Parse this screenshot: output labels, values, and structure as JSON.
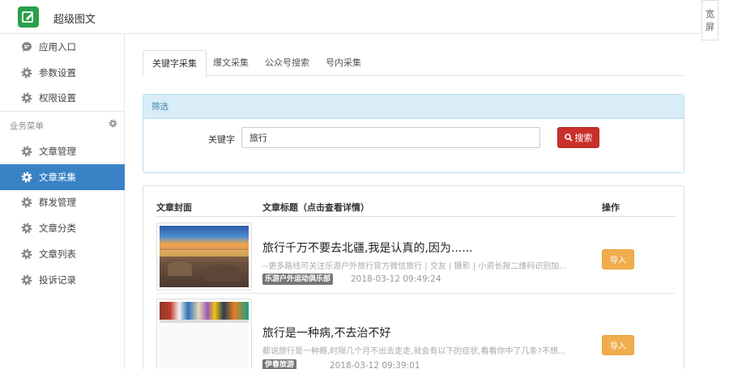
{
  "app": {
    "title": "超级图文",
    "wide_label": "宽屏"
  },
  "sidebar": {
    "top_items": [
      {
        "label": "应用入口",
        "icon": "chat-bubble-icon"
      },
      {
        "label": "参数设置",
        "icon": "gear-icon"
      },
      {
        "label": "权限设置",
        "icon": "gear-icon"
      }
    ],
    "section_label": "业务菜单",
    "items": [
      {
        "label": "文章管理",
        "icon": "gear-icon"
      },
      {
        "label": "文章采集",
        "icon": "gear-icon",
        "active": true
      },
      {
        "label": "群发管理",
        "icon": "gear-icon"
      },
      {
        "label": "文章分类",
        "icon": "gear-icon"
      },
      {
        "label": "文章列表",
        "icon": "gear-icon"
      },
      {
        "label": "投诉记录",
        "icon": "gear-icon"
      }
    ]
  },
  "tabs": [
    {
      "label": "关键字采集",
      "active": true
    },
    {
      "label": "爆文采集"
    },
    {
      "label": "公众号搜索"
    },
    {
      "label": "号内采集"
    }
  ],
  "filter": {
    "heading": "筛选",
    "keyword_label": "关键字",
    "keyword_value": "旅行",
    "search_label": "搜索"
  },
  "table": {
    "headers": {
      "cover": "文章封面",
      "title": "文章标题（点击查看详情）",
      "action": "操作"
    },
    "rows": [
      {
        "title": "旅行千万不要去北疆,我是认真的,因为......",
        "desc": "--更多路线可关注乐游户外旅行官方微信旅行 | 交友 | 摄影 | 小资长按二维码识别加...",
        "tag": "乐游户外运动俱乐部",
        "time": "2018-03-12 09:49:24",
        "action": "导入"
      },
      {
        "title": "旅行是一种病,不去治不好",
        "desc": "都说旅行是一种瘾,时隔几个月不出去走走,就会有以下的症状,看看你中了几条?不想...",
        "tag": "伊春旅游",
        "time": "2018-03-12 09:39:01",
        "action": "导入"
      }
    ]
  },
  "colors": {
    "brand": "#29a04a",
    "active_nav": "#3a82c6",
    "search_button": "#c9302c",
    "import_button": "#f0ad4e",
    "panel_heading_bg": "#d9edf7"
  }
}
